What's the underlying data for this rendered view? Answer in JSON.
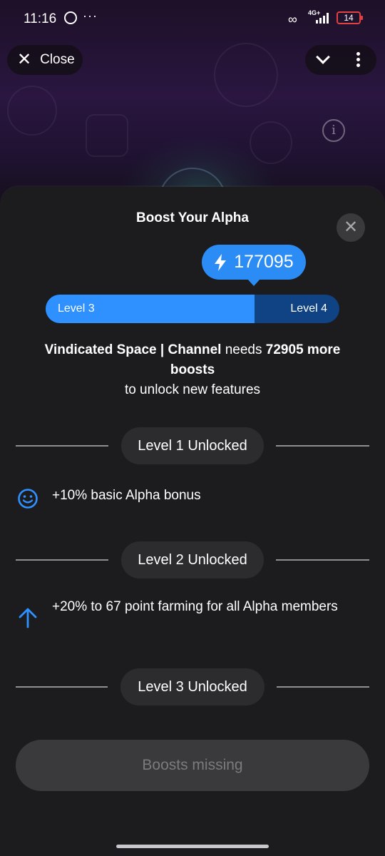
{
  "status_bar": {
    "time": "11:16",
    "more_indicator": "···",
    "network": "4G+",
    "battery": "14"
  },
  "header": {
    "close_label": "Close",
    "close_icon": "close-icon",
    "chevron_icon": "chevron-down-icon",
    "menu_icon": "more-vertical-icon",
    "info_icon": "info-icon"
  },
  "sheet": {
    "title": "Boost Your Alpha",
    "boost_count": "177095",
    "progress": {
      "current_level": "Level 3",
      "next_level": "Level 4",
      "fraction": 0.71
    },
    "needs": {
      "channel": "Vindicated Space | Channel",
      "needs_word": "needs",
      "amount": "72905 more boosts",
      "tail": "to unlock new features"
    },
    "levels": [
      {
        "label": "Level 1 Unlocked",
        "perk": "+10% basic Alpha bonus",
        "icon": "smile-icon"
      },
      {
        "label": "Level 2 Unlocked",
        "perk": "+20% to 67 point farming for all Alpha members",
        "icon": "arrow-up-icon"
      },
      {
        "label": "Level 3 Unlocked"
      }
    ],
    "cta_label": "Boosts missing"
  },
  "colors": {
    "accent": "#2f91ff",
    "progress_track": "#0f4383",
    "sheet_bg": "#1c1c1e",
    "chip_bg": "#2c2c2e",
    "battery_low": "#e04141"
  }
}
